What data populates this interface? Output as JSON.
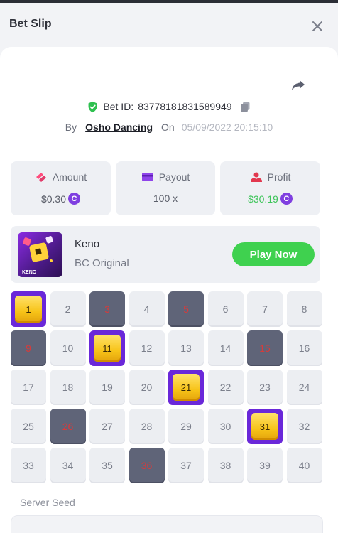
{
  "header": {
    "title": "Bet Slip",
    "close_icon": "close-icon"
  },
  "bet": {
    "id_label": "Bet ID:",
    "id_value": "83778181831589949",
    "by_label": "By",
    "user": "Osho Dancing",
    "on_label": "On",
    "datetime": "05/09/2022 20:15:10"
  },
  "stats": {
    "amount": {
      "label": "Amount",
      "value": "$0.30",
      "coin": "C"
    },
    "payout": {
      "label": "Payout",
      "value": "100 x"
    },
    "profit": {
      "label": "Profit",
      "value": "$30.19",
      "coin": "C"
    }
  },
  "game": {
    "name": "Keno",
    "provider": "BC Original",
    "play_label": "Play Now",
    "thumb_text": "KENO"
  },
  "grid": {
    "numbers": [
      1,
      2,
      3,
      4,
      5,
      6,
      7,
      8,
      9,
      10,
      11,
      12,
      13,
      14,
      15,
      16,
      17,
      18,
      19,
      20,
      21,
      22,
      23,
      24,
      25,
      26,
      27,
      28,
      29,
      30,
      31,
      32,
      33,
      34,
      35,
      36,
      37,
      38,
      39,
      40
    ],
    "hits": [
      1,
      11,
      21,
      31
    ],
    "picked_misses": [
      3,
      5,
      9,
      15,
      26,
      36
    ]
  },
  "seed": {
    "label": "Server Seed"
  },
  "colors": {
    "accent_purple": "#6a28d9",
    "play_green": "#3fd14f",
    "profit_green": "#3ec45a",
    "pick_red": "#d63b3b"
  }
}
